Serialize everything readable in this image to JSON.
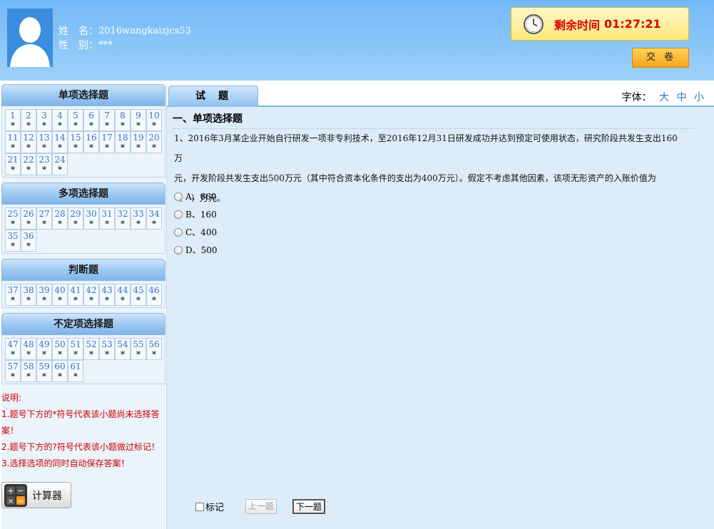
{
  "user": {
    "name_label": "姓　名：",
    "name_value": "2016wangkaizjcs53",
    "gender_label": "性　别：",
    "gender_value": "***"
  },
  "timer": {
    "label": "剩余时间",
    "value": "01:27:21"
  },
  "submit_label": "交卷",
  "sections": [
    {
      "title": "单项选择题",
      "questions": [
        {
          "n": "1",
          "s": "*"
        },
        {
          "n": "2",
          "s": "*"
        },
        {
          "n": "3",
          "s": "*"
        },
        {
          "n": "4",
          "s": "*"
        },
        {
          "n": "5",
          "s": "*"
        },
        {
          "n": "6",
          "s": "*"
        },
        {
          "n": "7",
          "s": "*"
        },
        {
          "n": "8",
          "s": "*"
        },
        {
          "n": "9",
          "s": "*"
        },
        {
          "n": "10",
          "s": "*"
        },
        {
          "n": "11",
          "s": "*"
        },
        {
          "n": "12",
          "s": "*"
        },
        {
          "n": "13",
          "s": "*"
        },
        {
          "n": "14",
          "s": "*"
        },
        {
          "n": "15",
          "s": "*"
        },
        {
          "n": "16",
          "s": "*"
        },
        {
          "n": "17",
          "s": "*"
        },
        {
          "n": "18",
          "s": "*"
        },
        {
          "n": "19",
          "s": "*"
        },
        {
          "n": "20",
          "s": "*"
        },
        {
          "n": "21",
          "s": "*"
        },
        {
          "n": "22",
          "s": "*"
        },
        {
          "n": "23",
          "s": "*"
        },
        {
          "n": "24",
          "s": "*"
        }
      ]
    },
    {
      "title": "多项选择题",
      "questions": [
        {
          "n": "25",
          "s": "*"
        },
        {
          "n": "26",
          "s": "*"
        },
        {
          "n": "27",
          "s": "*"
        },
        {
          "n": "28",
          "s": "*"
        },
        {
          "n": "29",
          "s": "*"
        },
        {
          "n": "30",
          "s": "*"
        },
        {
          "n": "31",
          "s": "*"
        },
        {
          "n": "32",
          "s": "*"
        },
        {
          "n": "33",
          "s": "*"
        },
        {
          "n": "34",
          "s": "*"
        },
        {
          "n": "35",
          "s": "*"
        },
        {
          "n": "36",
          "s": "*"
        }
      ]
    },
    {
      "title": "判断题",
      "questions": [
        {
          "n": "37",
          "s": "*"
        },
        {
          "n": "38",
          "s": "*"
        },
        {
          "n": "39",
          "s": "*"
        },
        {
          "n": "40",
          "s": "*"
        },
        {
          "n": "41",
          "s": "*"
        },
        {
          "n": "42",
          "s": "*"
        },
        {
          "n": "43",
          "s": "*"
        },
        {
          "n": "44",
          "s": "*"
        },
        {
          "n": "45",
          "s": "*"
        },
        {
          "n": "46",
          "s": "*"
        }
      ]
    },
    {
      "title": "不定项选择题",
      "questions": [
        {
          "n": "47",
          "s": "*"
        },
        {
          "n": "48",
          "s": "*"
        },
        {
          "n": "49",
          "s": "*"
        },
        {
          "n": "50",
          "s": "*"
        },
        {
          "n": "51",
          "s": "*"
        },
        {
          "n": "52",
          "s": "*"
        },
        {
          "n": "53",
          "s": "*"
        },
        {
          "n": "54",
          "s": "*"
        },
        {
          "n": "55",
          "s": "*"
        },
        {
          "n": "56",
          "s": "*"
        },
        {
          "n": "57",
          "s": "*"
        },
        {
          "n": "58",
          "s": "*"
        },
        {
          "n": "59",
          "s": "*"
        },
        {
          "n": "60",
          "s": "*"
        },
        {
          "n": "61",
          "s": "*"
        }
      ]
    }
  ],
  "notes": {
    "title": "说明:",
    "items": [
      "1.题号下方的*符号代表该小题尚未选择答案！",
      "2.题号下方的?符号代表该小题做过标记！",
      "3.选择选项的同时自动保存答案！"
    ]
  },
  "calculator_label": "计算器",
  "main": {
    "tab_label": "试题",
    "font_label": "字体：",
    "font_options": [
      "大",
      "中",
      "小"
    ],
    "section_heading": "一、单项选择题",
    "question_lines": [
      "1、2016年3月某企业开始自行研发一项非专利技术，至2016年12月31日研发成功并达到预定可使用状态，研究阶段共发生支出160万",
      "元，开发阶段共发生支出500万元（其中符合资本化条件的支出为400万元）。假定不考虑其他因素，该项无形资产的入账价值为",
      "（　）万元。"
    ],
    "options": [
      "A、660",
      "B、160",
      "C、400",
      "D、500"
    ],
    "mark_label": "标记",
    "prev_label": "上一题",
    "next_label": "下一题"
  },
  "colors": {
    "header_bg": "#8cc7f9",
    "timer_text": "#e00000",
    "qnum": "#2f74c9",
    "notes": "#d00000"
  }
}
